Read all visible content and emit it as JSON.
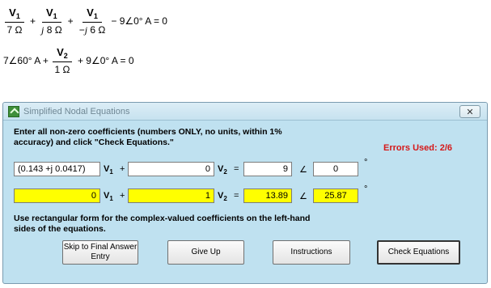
{
  "equations": {
    "eq1": {
      "t1_num": "V",
      "t1_num_sub": "1",
      "t1_den": "7 Ω",
      "t2_num": "V",
      "t2_num_sub": "1",
      "t2_den_j": "j",
      "t2_den": " 8 Ω",
      "t3_num": "V",
      "t3_num_sub": "1",
      "t3_den_pre": "−",
      "t3_den_j": "j",
      "t3_den": " 6 Ω",
      "plus1": "+",
      "plus2": "+",
      "tail": "− 9∠0° A = 0"
    },
    "eq2": {
      "lead": "7∠60° A +",
      "t1_num": "V",
      "t1_num_sub": "2",
      "t1_den": "1 Ω",
      "tail": "+ 9∠0° A = 0"
    }
  },
  "dialog": {
    "title": "Simplified Nodal Equations",
    "close_label": "✕",
    "instructions": "Enter all non-zero coefficients (numbers ONLY, no units, within 1% accuracy) and click \"Check Equations.\"",
    "errors_label": "Errors Used:",
    "errors_value": "2/6",
    "row1": {
      "coef1": "(0.143 +j 0.0417)",
      "v1_label": "V",
      "v1_sub": "1",
      "plus": "+",
      "coef2": "0",
      "v2_label": "V",
      "v2_sub": "2",
      "equals": "=",
      "magnitude": "9",
      "angle_symbol": "∠",
      "angle": "0",
      "degree": "°"
    },
    "row2": {
      "coef1": "0",
      "v1_label": "V",
      "v1_sub": "1",
      "plus": "+",
      "coef2": "1",
      "v2_label": "V",
      "v2_sub": "2",
      "equals": "=",
      "magnitude": "13.89",
      "angle_symbol": "∠",
      "angle": "25.87",
      "degree": "°"
    },
    "note": "Use rectangular form for the complex-valued coefficients on the left-hand sides of the equations.",
    "buttons": {
      "skip": "Skip to Final Answer Entry",
      "give_up": "Give Up",
      "instructions": "Instructions",
      "check": "Check Equations"
    }
  },
  "colors": {
    "dialog_bg": "#bfe1f0",
    "highlight": "#ffff00",
    "error_text": "#d61818"
  }
}
